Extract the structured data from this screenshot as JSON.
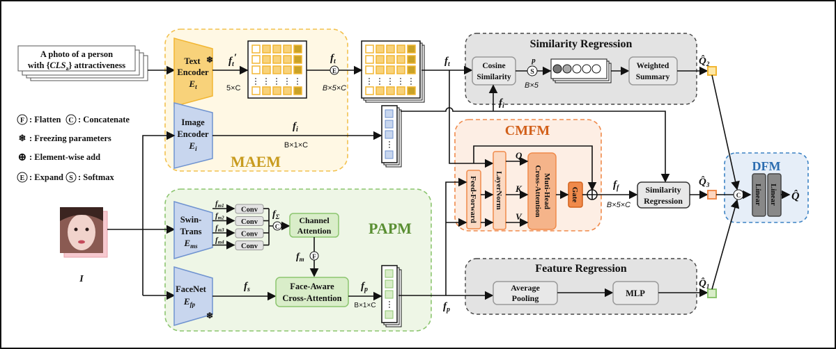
{
  "prompt": {
    "line1": "A photo of a person",
    "line2_pre": "with {",
    "line2_cls": "CLS",
    "line2_sub": "a",
    "line2_post": "} attractiveness"
  },
  "legend": {
    "flatten_sym": "F",
    "flatten": ": Flatten",
    "concat_sym": "C",
    "concat": ": Concatenate",
    "freeze_sym": "❄",
    "freeze": ": Freezing parameters",
    "add_sym": "⊕",
    "add": ": Element-wise add",
    "expand_sym": "E",
    "expand": ": Expand",
    "softmax_sym": "S",
    "softmax": ": Softmax"
  },
  "image_label": "I",
  "maem": {
    "title": "MAEM",
    "text_encoder": {
      "l1": "Text",
      "l2": "Encoder",
      "sym": "E",
      "sub": "t"
    },
    "image_encoder": {
      "l1": "Image",
      "l2": "Encoder",
      "sym": "E",
      "sub": "i"
    },
    "ft_prime": {
      "f": "f",
      "sub": "t",
      "prime": "′"
    },
    "dim_5c": "5×C",
    "ft": {
      "f": "f",
      "sub": "t"
    },
    "dim_b5c": "B×5×C",
    "fi": {
      "f": "f",
      "sub": "i"
    },
    "dim_b1c": "B×1×C",
    "expand": "E"
  },
  "papm": {
    "title": "PAPM",
    "swin": {
      "l1": "Swin-",
      "l2": "Trans",
      "sym": "E",
      "sub": "ms"
    },
    "facenet": {
      "l1": "FaceNet",
      "sym": "E",
      "sub": "fp"
    },
    "scales": [
      {
        "f": "f",
        "sub": "m1"
      },
      {
        "f": "f",
        "sub": "m2"
      },
      {
        "f": "f",
        "sub": "m3"
      },
      {
        "f": "f",
        "sub": "m4"
      }
    ],
    "conv": "Conv",
    "fsigma": {
      "f": "f",
      "sub": "Σ"
    },
    "concat": "C",
    "channel_attention": {
      "l1": "Channel",
      "l2": "Attention"
    },
    "fm": {
      "f": "f",
      "sub": "m"
    },
    "flatten": "F",
    "fs": {
      "f": "f",
      "sub": "s"
    },
    "face_aware": {
      "l1": "Face-Aware",
      "l2": "Cross-Attention"
    },
    "fp": {
      "f": "f",
      "sub": "p"
    },
    "dim_b1c": "B×1×C"
  },
  "similarity_regression": {
    "title": "Similarity Regression",
    "cosine": {
      "l1": "Cosine",
      "l2": "Similarity"
    },
    "p": "p",
    "softmax": "S",
    "dim_b5": "B×5",
    "weighted": {
      "l1": "Weighted",
      "l2": "Summary"
    },
    "q2": {
      "q": "Q̂",
      "sub": "2"
    }
  },
  "cmfm": {
    "title": "CMFM",
    "feed_forward": "Feed-Forward",
    "layernorm": "LayerNorm",
    "mha": {
      "l1": "Muti-Head",
      "l2": "Cross-Attention"
    },
    "gate": "Gate",
    "q": "Q",
    "k": "K",
    "v": "V",
    "ff": {
      "f": "f",
      "sub": "f"
    },
    "dim_b5c": "B×5×C",
    "fi": {
      "f": "f",
      "sub": "i"
    },
    "ft": {
      "f": "f",
      "sub": "t"
    },
    "fp": {
      "f": "f",
      "sub": "p"
    },
    "sim_reg": {
      "l1": "Similarity",
      "l2": "Regression"
    },
    "q3": {
      "q": "Q̂",
      "sub": "3"
    }
  },
  "feature_regression": {
    "title": "Feature Regression",
    "avg": {
      "l1": "Average",
      "l2": "Pooling"
    },
    "mlp": "MLP",
    "q1": {
      "q": "Q̂",
      "sub": "1"
    }
  },
  "dfm": {
    "title": "DFM",
    "concat": "C",
    "linear": "Linear",
    "out": "Q̂"
  },
  "colors": {
    "maem": "#f2c14e",
    "papm": "#8cc56f",
    "cmfm": "#f08a4b",
    "dfm": "#3b82c4",
    "encoder_blue": "#c8d6ee",
    "grey": "#e3e3e3"
  }
}
